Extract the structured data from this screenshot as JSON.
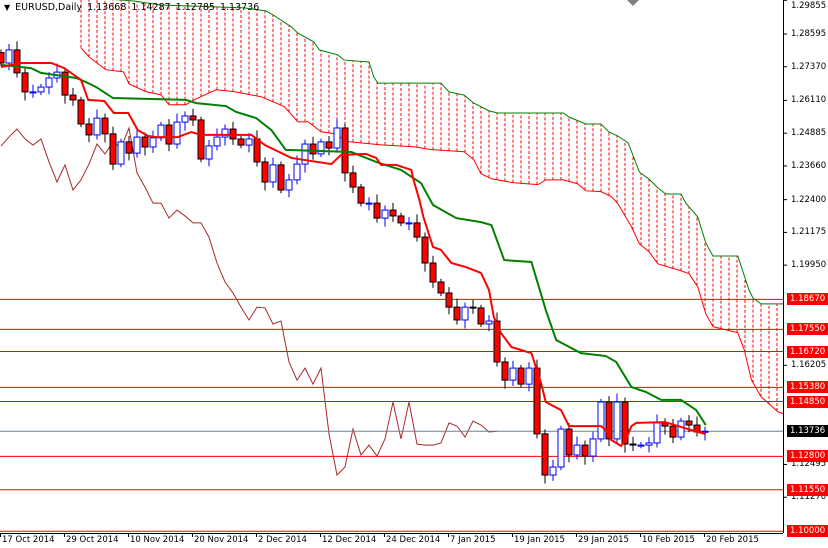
{
  "header": {
    "menu_icon": "triangle-down-icon",
    "symbol": "EURUSD,Daily",
    "open": "1.13668",
    "high": "1.14287",
    "low": "1.12785",
    "close": "1.13736"
  },
  "colors": {
    "bull": "#0000ff",
    "bear": "#ff0000",
    "tenkan": "#ff0000",
    "kijun": "#008000",
    "chikou": "#a52a2a",
    "cloud": "#ff0000",
    "level": "#ff0000",
    "current": "#708090"
  },
  "chart_data": {
    "type": "candlestick",
    "symbol": "EURUSD",
    "timeframe": "Daily",
    "ylim": [
      1.1,
      1.29855
    ],
    "price_axis_ticks": [
      "1.29855",
      "1.28595",
      "1.27370",
      "1.26110",
      "1.24885",
      "1.23660",
      "1.22400",
      "1.21175",
      "1.19950",
      "1.16205",
      "1.12495",
      "1.11270"
    ],
    "date_labels": [
      "17 Oct 2014",
      "29 Oct 2014",
      "10 Nov 2014",
      "20 Nov 2014",
      "2 Dec 2014",
      "12 Dec 2014",
      "24 Dec 2014",
      "7 Jan 2015",
      "19 Jan 2015",
      "29 Jan 2015",
      "10 Feb 2015",
      "20 Feb 2015"
    ],
    "closes": [
      1.2751,
      1.28,
      1.2714,
      1.2643,
      1.2643,
      1.2661,
      1.2695,
      1.2717,
      1.2631,
      1.2613,
      1.2523,
      1.2482,
      1.2545,
      1.2486,
      1.2373,
      1.2456,
      1.2414,
      1.2474,
      1.2437,
      1.2471,
      1.2519,
      1.2448,
      1.253,
      1.2553,
      1.2538,
      1.2392,
      1.2441,
      1.2474,
      1.2504,
      1.2467,
      1.2444,
      1.2467,
      1.2381,
      1.2306,
      1.237,
      1.2276,
      1.2314,
      1.2373,
      1.2448,
      1.2411,
      1.2456,
      1.2433,
      1.2508,
      1.234,
      1.2287,
      1.2227,
      1.2227,
      1.2171,
      1.2201,
      1.2179,
      1.2153,
      1.2153,
      1.21,
      1.2003,
      1.1932,
      1.1891,
      1.1838,
      1.179,
      1.1838,
      1.1835,
      1.1775,
      1.1786,
      1.1633,
      1.1565,
      1.161,
      1.155,
      1.161,
      1.1364,
      1.121,
      1.124,
      1.1382,
      1.1285,
      1.1322,
      1.1281,
      1.1345,
      1.1483,
      1.1345,
      1.1483,
      1.1326,
      1.1322,
      1.1322,
      1.133,
      1.1405,
      1.1393,
      1.1352,
      1.1412,
      1.1397,
      1.1371,
      1.13736
    ],
    "first_open": 1.279,
    "tenkan_sen": [
      [
        0,
        1.2736
      ],
      [
        2.5,
        1.2751
      ],
      [
        6.3,
        1.2751
      ],
      [
        7.9,
        1.2732
      ],
      [
        10,
        1.2688
      ],
      [
        10.9,
        1.2613
      ],
      [
        12.9,
        1.2609
      ],
      [
        14.1,
        1.2564
      ],
      [
        15.9,
        1.2564
      ],
      [
        17.1,
        1.25
      ],
      [
        18.4,
        1.2478
      ],
      [
        19.4,
        1.2474
      ],
      [
        22.1,
        1.2474
      ],
      [
        23.8,
        1.2493
      ],
      [
        25,
        1.2482
      ],
      [
        31.3,
        1.2482
      ],
      [
        33,
        1.2444
      ],
      [
        36.3,
        1.2396
      ],
      [
        41.3,
        1.2373
      ],
      [
        42.5,
        1.2407
      ],
      [
        45.6,
        1.2411
      ],
      [
        46.9,
        1.2396
      ],
      [
        47.5,
        1.237
      ],
      [
        49.4,
        1.237
      ],
      [
        51.3,
        1.2351
      ],
      [
        51.5,
        1.2321
      ],
      [
        52.3,
        1.2239
      ],
      [
        52.8,
        1.2175
      ],
      [
        54,
        1.2063
      ],
      [
        55,
        1.2052
      ],
      [
        56.3,
        1.2003
      ],
      [
        58.1,
        1.1988
      ],
      [
        60,
        1.1966
      ],
      [
        61,
        1.1902
      ],
      [
        61.6,
        1.1801
      ],
      [
        62.5,
        1.1741
      ],
      [
        63.8,
        1.1689
      ],
      [
        66.3,
        1.1666
      ],
      [
        67.5,
        1.1554
      ],
      [
        68.1,
        1.1483
      ],
      [
        70,
        1.1453
      ],
      [
        71,
        1.1393
      ],
      [
        75,
        1.1393
      ],
      [
        75.6,
        1.1378
      ],
      [
        76.3,
        1.1341
      ],
      [
        77.5,
        1.1319
      ],
      [
        78.1,
        1.1341
      ],
      [
        78.8,
        1.1393
      ],
      [
        79.4,
        1.1405
      ],
      [
        83,
        1.1408
      ],
      [
        85,
        1.139
      ],
      [
        86.3,
        1.1378
      ],
      [
        88.1,
        1.1363
      ]
    ],
    "kijun_sen": [
      [
        0,
        1.2744
      ],
      [
        3.75,
        1.2732
      ],
      [
        5,
        1.2714
      ],
      [
        9.4,
        1.2695
      ],
      [
        10.6,
        1.268
      ],
      [
        11.9,
        1.2661
      ],
      [
        14,
        1.262
      ],
      [
        23.1,
        1.2613
      ],
      [
        24.4,
        1.2601
      ],
      [
        28.1,
        1.259
      ],
      [
        29.4,
        1.2568
      ],
      [
        31.9,
        1.2545
      ],
      [
        33.8,
        1.25
      ],
      [
        35.6,
        1.2426
      ],
      [
        43.8,
        1.2418
      ],
      [
        46.9,
        1.2381
      ],
      [
        50,
        1.2351
      ],
      [
        52.5,
        1.2302
      ],
      [
        54,
        1.222
      ],
      [
        56.9,
        1.2171
      ],
      [
        60,
        1.2156
      ],
      [
        61.3,
        1.2145
      ],
      [
        62.9,
        1.2014
      ],
      [
        66.3,
        1.2007
      ],
      [
        68.1,
        1.1827
      ],
      [
        69.4,
        1.1715
      ],
      [
        72.5,
        1.1666
      ],
      [
        75.6,
        1.1655
      ],
      [
        76.9,
        1.1633
      ],
      [
        78.8,
        1.1539
      ],
      [
        80.6,
        1.1521
      ],
      [
        82.5,
        1.1491
      ],
      [
        85,
        1.1491
      ],
      [
        86.9,
        1.1453
      ],
      [
        88.1,
        1.1397
      ]
    ],
    "chikou_shift": 26,
    "senkou_span_b": [
      [
        10,
        1.2998
      ],
      [
        16.6,
        1.2983
      ],
      [
        20,
        1.2968
      ],
      [
        30.4,
        1.2957
      ],
      [
        33.1,
        1.2946
      ],
      [
        34,
        1.2931
      ],
      [
        36.3,
        1.2886
      ],
      [
        37.1,
        1.2863
      ],
      [
        39.1,
        1.283
      ],
      [
        39.8,
        1.28
      ],
      [
        42.1,
        1.2781
      ],
      [
        42.9,
        1.2762
      ],
      [
        46,
        1.2755
      ],
      [
        46.6,
        1.2699
      ],
      [
        47.1,
        1.2676
      ],
      [
        55,
        1.2676
      ],
      [
        56,
        1.2643
      ],
      [
        57.9,
        1.2631
      ],
      [
        59.1,
        1.2601
      ],
      [
        61,
        1.2572
      ],
      [
        62.1,
        1.2564
      ],
      [
        70.3,
        1.2564
      ],
      [
        71,
        1.2549
      ],
      [
        73.1,
        1.2523
      ],
      [
        75,
        1.2523
      ],
      [
        76,
        1.2493
      ],
      [
        77.1,
        1.2478
      ],
      [
        78.4,
        1.2452
      ],
      [
        79.8,
        1.2343
      ],
      [
        81,
        1.2317
      ],
      [
        82.1,
        1.2284
      ],
      [
        83.1,
        1.2261
      ],
      [
        85,
        1.2261
      ],
      [
        85.6,
        1.2227
      ],
      [
        87.1,
        1.2175
      ],
      [
        88.1,
        1.2078
      ],
      [
        89,
        1.2029
      ],
      [
        92.1,
        1.2029
      ],
      [
        93.5,
        1.1902
      ],
      [
        94,
        1.1872
      ],
      [
        95,
        1.185
      ],
      [
        98.1,
        1.185
      ]
    ],
    "senkou_span_a": [
      [
        10,
        1.2808
      ],
      [
        11,
        1.2774
      ],
      [
        13.1,
        1.2726
      ],
      [
        15.3,
        1.2718
      ],
      [
        16,
        1.2673
      ],
      [
        18.1,
        1.2644
      ],
      [
        20,
        1.2632
      ],
      [
        21,
        1.2595
      ],
      [
        23.1,
        1.2595
      ],
      [
        24.4,
        1.2617
      ],
      [
        26.9,
        1.2651
      ],
      [
        29.1,
        1.2644
      ],
      [
        32.5,
        1.2625
      ],
      [
        35.4,
        1.2588
      ],
      [
        37.1,
        1.2531
      ],
      [
        38.4,
        1.2531
      ],
      [
        40,
        1.2494
      ],
      [
        41.6,
        1.2487
      ],
      [
        43.4,
        1.2457
      ],
      [
        47.5,
        1.2445
      ],
      [
        51.6,
        1.2438
      ],
      [
        53.8,
        1.2427
      ],
      [
        57.9,
        1.2419
      ],
      [
        59.1,
        1.2389
      ],
      [
        60,
        1.2337
      ],
      [
        61.3,
        1.2318
      ],
      [
        64.1,
        1.2303
      ],
      [
        67.1,
        1.2296
      ],
      [
        68.1,
        1.2314
      ],
      [
        70.3,
        1.2314
      ],
      [
        72.1,
        1.2299
      ],
      [
        73.1,
        1.2273
      ],
      [
        75,
        1.227
      ],
      [
        76.3,
        1.2251
      ],
      [
        77.1,
        1.2225
      ],
      [
        78.8,
        1.2139
      ],
      [
        79.8,
        1.2075
      ],
      [
        81,
        1.2045
      ],
      [
        82.1,
        1.2
      ],
      [
        85,
        1.1974
      ],
      [
        86,
        1.1963
      ],
      [
        87.1,
        1.1914
      ],
      [
        88.1,
        1.1813
      ],
      [
        89,
        1.1765
      ],
      [
        92.1,
        1.1742
      ],
      [
        92.9,
        1.1679
      ],
      [
        93.8,
        1.1566
      ],
      [
        95,
        1.1503
      ],
      [
        97.1,
        1.1447
      ],
      [
        98.1,
        1.1436
      ]
    ],
    "horizontal_levels": [
      "1.18670",
      "1.17550",
      "1.16720",
      "1.15380",
      "1.14850",
      "1.12800",
      "1.11550",
      "1.10000"
    ],
    "current_price": "1.13736"
  }
}
